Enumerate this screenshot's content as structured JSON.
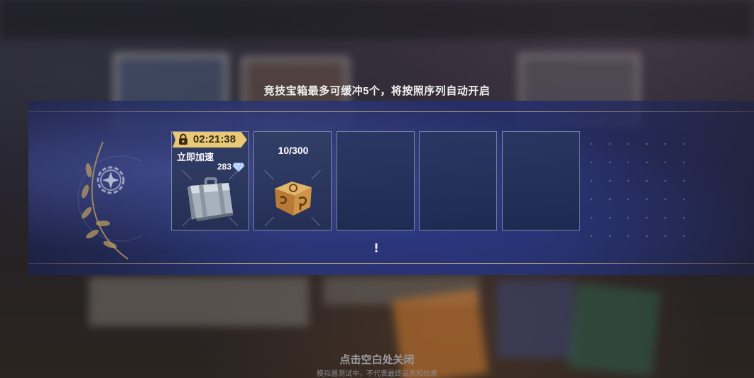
{
  "notice": "竞技宝箱最多可缓冲5个，将按照序列自动开启",
  "slots": [
    {
      "state": "unlocking",
      "timer": "02:21:38",
      "speed_up_label": "立即加速",
      "gem_cost": "283",
      "item_icon": "silver-suitcase-icon",
      "timer_badge_color": "#e9c977"
    },
    {
      "state": "progress",
      "progress": "10/300",
      "item_icon": "bronze-cube-chest-icon"
    },
    {
      "state": "empty"
    },
    {
      "state": "empty"
    },
    {
      "state": "empty"
    }
  ],
  "icons": {
    "lock": "lock-icon",
    "gem": "diamond-gem-icon",
    "info": "exclamation-icon",
    "emblem": "gear-star-emblem-icon"
  },
  "footer": {
    "close_hint": "点击空白处关闭",
    "emulator_note": "模拟器测试中，不代表最终品质和效果"
  },
  "colors": {
    "accent_gold": "#e9c977",
    "band_blue": "#2c3876"
  }
}
